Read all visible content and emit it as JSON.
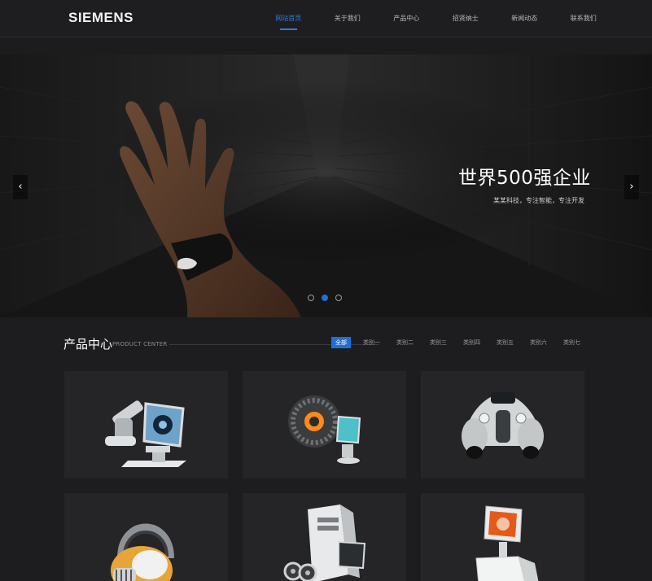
{
  "header": {
    "logo": "SIEMENS",
    "nav": [
      "网站首页",
      "关于我们",
      "产品中心",
      "招贤纳士",
      "新闻动态",
      "联系我们"
    ],
    "active_index": 0,
    "accent": "#2f7bd8"
  },
  "banner": {
    "title": "世界500强企业",
    "subtitle": "某某科技，专注智能，专注开发",
    "prev_icon": "‹",
    "next_icon": "›",
    "slides": 3,
    "active_slide": 1
  },
  "products": {
    "title": "产品中心",
    "subtitle": "PRODUCT CENTER",
    "tabs": [
      "全部",
      "类别一",
      "类别二",
      "类别三",
      "类别四",
      "类别五",
      "类别六",
      "类别七"
    ],
    "active_tab": 0,
    "items": [
      {
        "icon": "robot-computer-icon"
      },
      {
        "icon": "tire-monitor-icon"
      },
      {
        "icon": "vintage-car-icon"
      },
      {
        "icon": "headphones-icon"
      },
      {
        "icon": "pc-tower-icon"
      },
      {
        "icon": "display-kiosk-icon"
      }
    ]
  },
  "colors": {
    "background": "#1d1d1f",
    "card": "#252527",
    "active_tab": "#1f6fd6"
  }
}
